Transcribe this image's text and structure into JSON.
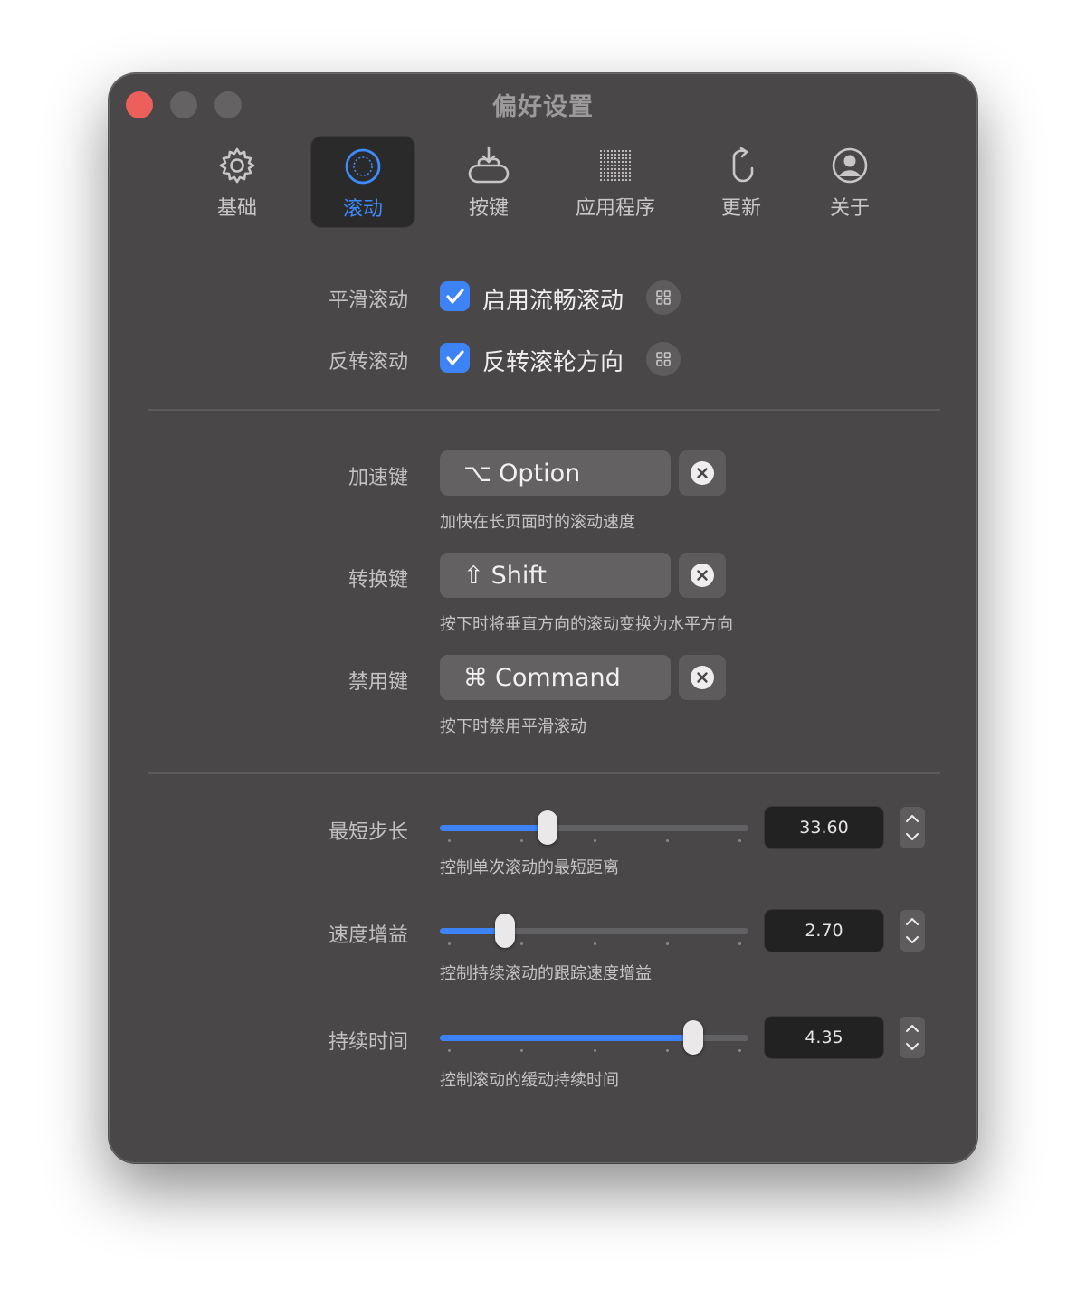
{
  "window": {
    "title": "偏好设置"
  },
  "toolbar": {
    "items": [
      {
        "label": "基础",
        "icon": "gear-icon",
        "active": false
      },
      {
        "label": "滚动",
        "icon": "scroll-circle-icon",
        "active": true
      },
      {
        "label": "按键",
        "icon": "key-tray-icon",
        "active": false
      },
      {
        "label": "应用程序",
        "icon": "app-grid-icon",
        "active": false
      },
      {
        "label": "更新",
        "icon": "refresh-mouse-icon",
        "active": false
      },
      {
        "label": "关于",
        "icon": "person-circle-icon",
        "active": false
      }
    ]
  },
  "scrolling": {
    "smooth": {
      "label": "平滑滚动",
      "checkbox_label": "启用流畅滚动",
      "checked": true
    },
    "reverse": {
      "label": "反转滚动",
      "checkbox_label": "反转滚轮方向",
      "checked": true
    }
  },
  "modifiers": {
    "accelerate": {
      "label": "加速键",
      "symbol": "⌥",
      "key": "Option",
      "hint": "加快在长页面时的滚动速度"
    },
    "convert": {
      "label": "转换键",
      "symbol": "⇧",
      "key": "Shift",
      "hint": "按下时将垂直方向的滚动变换为水平方向"
    },
    "disable": {
      "label": "禁用键",
      "symbol": "⌘",
      "key": "Command",
      "hint": "按下时禁用平滑滚动"
    }
  },
  "sliders": {
    "step": {
      "label": "最短步长",
      "value": "33.60",
      "fraction": 0.35,
      "hint": "控制单次滚动的最短距离"
    },
    "gain": {
      "label": "速度增益",
      "value": "2.70",
      "fraction": 0.21,
      "hint": "控制持续滚动的跟踪速度增益"
    },
    "duration": {
      "label": "持续时间",
      "value": "4.35",
      "fraction": 0.82,
      "hint": "控制滚动的缓动持续时间"
    }
  },
  "colors": {
    "accent": "#3d83f5",
    "window": "#4a4749",
    "close": "#ec5f5a"
  }
}
